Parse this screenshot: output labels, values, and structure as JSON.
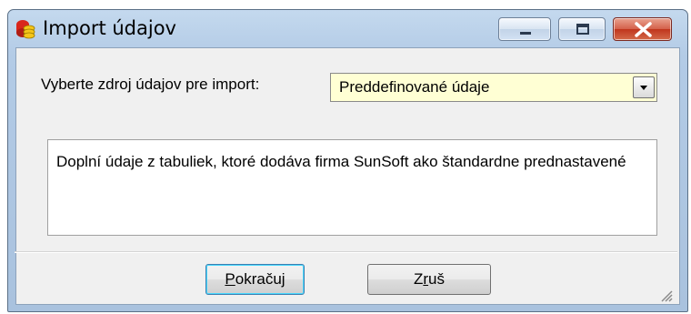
{
  "window": {
    "title": "Import údajov",
    "app_icon": "database-stack-icon",
    "controls": [
      "minimize-icon",
      "maximize-icon",
      "close-icon"
    ]
  },
  "source": {
    "label": "Vyberte zdroj údajov pre import:",
    "selected": "Preddefinované údaje"
  },
  "description": "Doplní údaje z tabuliek, ktoré dodáva firma SunSoft ako štandardne prednastavené",
  "buttons": {
    "ok_accel": "P",
    "ok_rest": "okračuj",
    "cancel_pre": "Z",
    "cancel_accel": "r",
    "cancel_rest": "uš"
  },
  "colors": {
    "combo_bg": "#ffffd4",
    "close_button": "#c0361d",
    "frame": "#b3cbe6"
  }
}
